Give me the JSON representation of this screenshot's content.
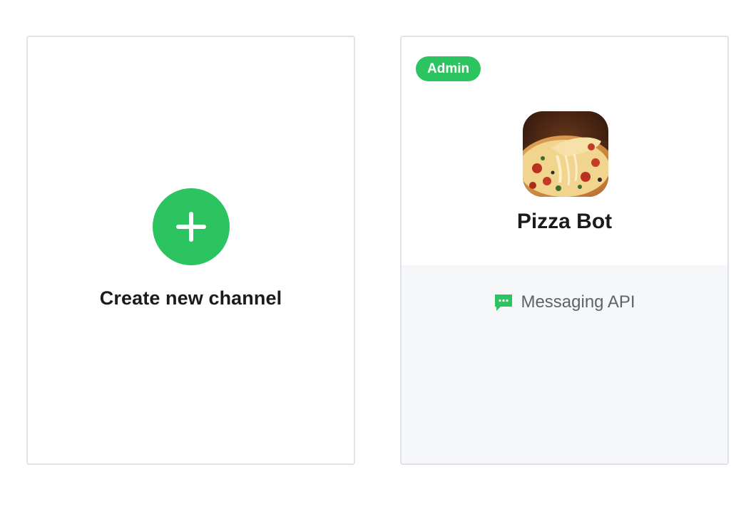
{
  "create_card": {
    "label": "Create new channel",
    "icon": "plus-icon",
    "accent": "#2cc361"
  },
  "channel_card": {
    "badge": "Admin",
    "name": "Pizza Bot",
    "avatar": "pizza-image",
    "type_icon": "chat-bubble-icon",
    "type_label": "Messaging API",
    "accent": "#2cc361",
    "background_bottom": "#f6f7f9"
  }
}
